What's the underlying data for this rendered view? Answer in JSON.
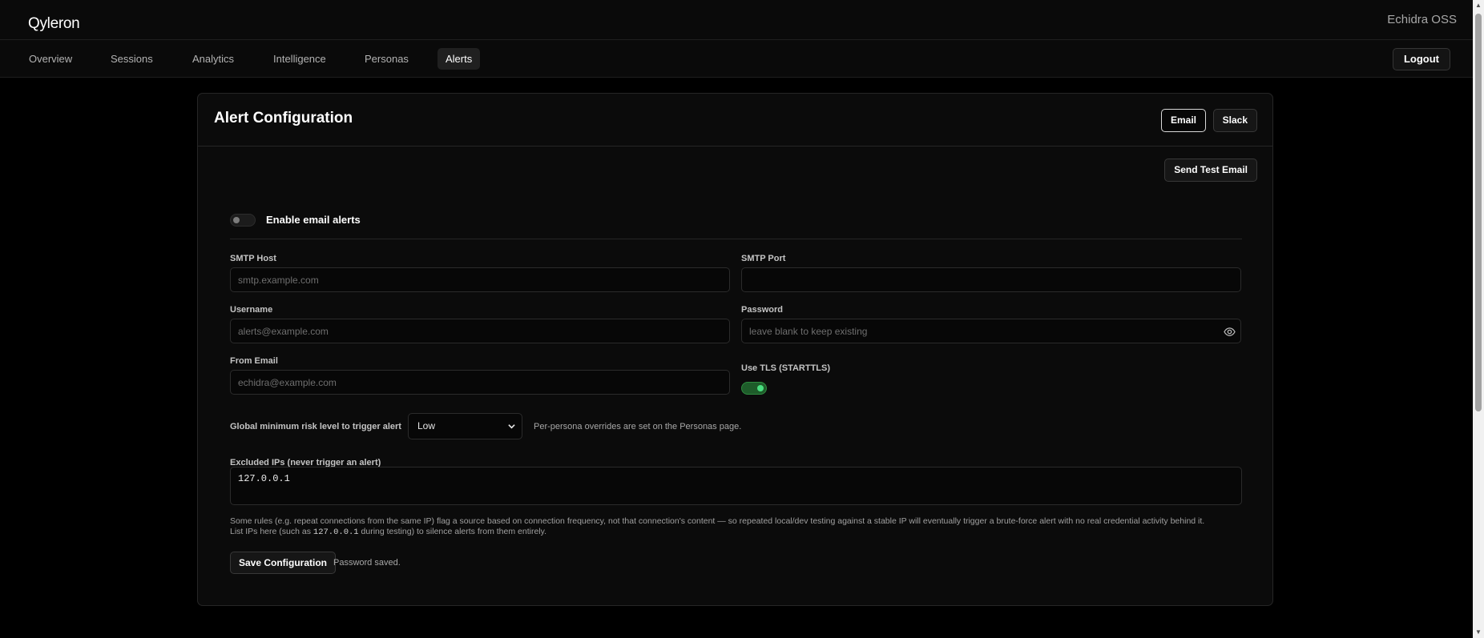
{
  "app": {
    "brand": "Qyleron",
    "product": "Echidra OSS"
  },
  "nav": {
    "tabs": [
      {
        "label": "Overview"
      },
      {
        "label": "Sessions"
      },
      {
        "label": "Analytics"
      },
      {
        "label": "Intelligence"
      },
      {
        "label": "Personas"
      },
      {
        "label": "Alerts",
        "active": true
      }
    ],
    "logout_label": "Logout"
  },
  "card": {
    "title": "Alert Configuration",
    "channels": {
      "email": "Email",
      "slack": "Slack",
      "selected": "Email"
    },
    "send_test_label": "Send Test Email"
  },
  "form": {
    "enable": {
      "label": "Enable email alerts",
      "checked": false
    },
    "smtp_host": {
      "label": "SMTP Host",
      "value": "",
      "placeholder": "smtp.example.com"
    },
    "smtp_port": {
      "label": "SMTP Port",
      "value": "",
      "placeholder": ""
    },
    "username": {
      "label": "Username",
      "value": "",
      "placeholder": "alerts@example.com"
    },
    "password": {
      "label": "Password",
      "value": "",
      "placeholder": "leave blank to keep existing",
      "icon": "eye-icon"
    },
    "from_email": {
      "label": "From Email",
      "value": "",
      "placeholder": "echidra@example.com"
    },
    "use_tls": {
      "label": "Use TLS (STARTTLS)",
      "checked": true
    },
    "risk": {
      "label": "Global minimum risk level to trigger alert",
      "selected": "Low",
      "note": "Per-persona overrides are set on the Personas page."
    },
    "excluded_ips": {
      "label": "Excluded IPs (never trigger an alert)",
      "value": "127.0.0.1",
      "help_line1": "Some rules (e.g. repeat connections from the same IP) flag a source based on connection frequency, not that connection's content — so repeated local/dev testing against a stable IP will eventually trigger a brute-force alert with no real credential activity behind it.",
      "help_line2_before": "List IPs here (such as ",
      "help_line2_code": "127.0.0.1",
      "help_line2_after": " during testing) to silence alerts from them entirely."
    },
    "save_label": "Save Configuration",
    "status": "Password saved."
  },
  "colors": {
    "accent_on": "#4ade80",
    "background": "#000000",
    "card": "#0b0b0b"
  }
}
